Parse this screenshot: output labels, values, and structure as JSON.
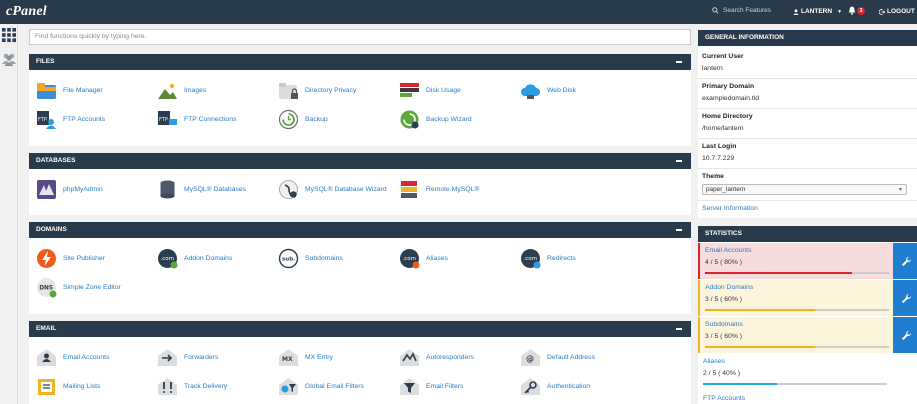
{
  "topbar": {
    "logo": "cPanel",
    "search_placeholder": "Search Features",
    "user": "LANTERN",
    "notifications": "3",
    "logout": "LOGOUT"
  },
  "quick_search": {
    "placeholder": "Find functions quickly by typing here."
  },
  "sections": {
    "files": {
      "title": "FILES",
      "items": [
        "File Manager",
        "Images",
        "Directory Privacy",
        "Disk Usage",
        "Web Disk",
        "FTP Accounts",
        "FTP Connections",
        "Backup",
        "Backup Wizard"
      ]
    },
    "databases": {
      "title": "DATABASES",
      "items": [
        "phpMyAdmin",
        "MySQL® Databases",
        "MySQL® Database Wizard",
        "Remote MySQL®"
      ]
    },
    "domains": {
      "title": "DOMAINS",
      "items": [
        "Site Publisher",
        "Addon Domains",
        "Subdomains",
        "Aliases",
        "Redirects",
        "Simple Zone Editor"
      ]
    },
    "email": {
      "title": "EMAIL",
      "items": [
        "Email Accounts",
        "Forwarders",
        "MX Entry",
        "Autoresponders",
        "Default Address",
        "Mailing Lists",
        "Track Delivery",
        "Global Email Filters",
        "Email Filters",
        "Authentication"
      ]
    }
  },
  "general": {
    "title": "GENERAL INFORMATION",
    "current_user_label": "Current User",
    "current_user": "lantern",
    "primary_domain_label": "Primary Domain",
    "primary_domain": "exampledomain.tld",
    "home_dir_label": "Home Directory",
    "home_dir": "/home/lantern",
    "last_login_label": "Last Login",
    "last_login": "10.7.7.229",
    "theme_label": "Theme",
    "theme_value": "paper_lantern",
    "server_info": "Server Information"
  },
  "statistics": {
    "title": "STATISTICS",
    "rows": [
      {
        "name": "Email Accounts",
        "value": "4 / 5 ( 80% )",
        "percent": 80,
        "state": "danger"
      },
      {
        "name": "Addon Domains",
        "value": "3 / 5 ( 60% )",
        "percent": 60,
        "state": "warning"
      },
      {
        "name": "Subdomains",
        "value": "3 / 5 ( 60% )",
        "percent": 60,
        "state": "warning"
      },
      {
        "name": "Aliases",
        "value": "2 / 5 ( 40% )",
        "percent": 40,
        "state": "normal"
      }
    ],
    "next_label": "FTP Accounts"
  },
  "colors": {
    "header": "#293a4a",
    "link": "#2b7bc5",
    "danger_bg": "#f6dcdc",
    "danger_bar": "#d9262c",
    "warning_bg": "#fcf5dc",
    "warning_bar": "#f0b323",
    "normal_bar": "#1fa6e0",
    "wrench": "#1f7ecf"
  }
}
